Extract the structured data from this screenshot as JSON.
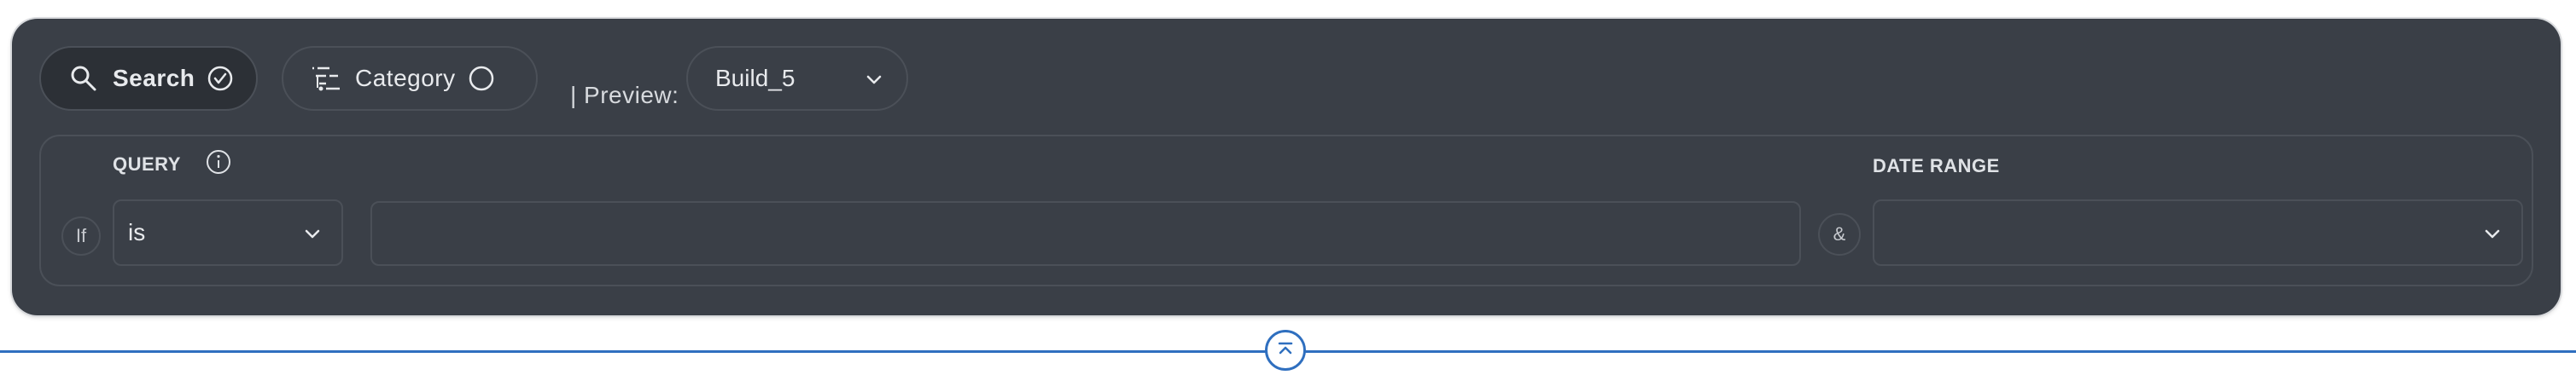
{
  "toolbar": {
    "search": {
      "label": "Search",
      "icon": "search-icon",
      "status_icon": "check-circle-icon"
    },
    "category": {
      "label": "Category",
      "icon": "filter-list-icon",
      "status_icon": "empty-circle-icon"
    },
    "preview_label": "| Preview:",
    "preview_select": {
      "value": "Build_5"
    }
  },
  "rule": {
    "if_label": "If",
    "and_label": "&",
    "query": {
      "label": "QUERY",
      "operator": "is",
      "value": ""
    },
    "date_range": {
      "label": "DATE RANGE",
      "value": ""
    }
  },
  "colors": {
    "panel_bg": "#3a3f47",
    "accent_blue": "#2f6fbf",
    "text": "#e8eaed"
  }
}
